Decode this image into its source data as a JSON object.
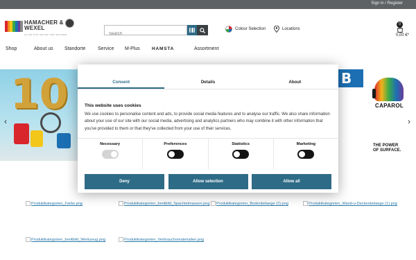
{
  "topbar": {
    "signin": "Sign in / Register"
  },
  "header": {
    "logo": {
      "name_line1": "HAMACHER &",
      "name_line2": "WEXEL",
      "tagline": "ALLES FÜR MALER UND MACHER"
    },
    "search": {
      "placeholder": "Search"
    },
    "colour_selection": "Colour Selection",
    "locations": "Locations",
    "cart": {
      "count": "0",
      "total": "0,00 €*"
    }
  },
  "nav": {
    "items": [
      "Shop",
      "About us",
      "Standorte",
      "Service",
      "M-Plus",
      "HAMSTA",
      "Assortment"
    ]
  },
  "hero": {
    "left_number": "10",
    "partial_letter": "B",
    "brand": "CAPAROL",
    "slogan_line1": "THE POWER",
    "slogan_line2": "OF SURFACE.",
    "prev_arrow": "‹",
    "next_arrow": "›"
  },
  "cookie_dialog": {
    "tabs": [
      {
        "label": "Consent",
        "active": true
      },
      {
        "label": "Details",
        "active": false
      },
      {
        "label": "About",
        "active": false
      }
    ],
    "title": "This website uses cookies",
    "body": "We use cookies to personalise content and ads, to provide social media features and to analyse our traffic. We also share information about your use of our site with our social media, advertising and analytics partners who may combine it with other information that you've provided to them or that they've collected from your use of their services.",
    "categories": [
      {
        "label": "Necessary",
        "enabled": true,
        "locked": true
      },
      {
        "label": "Preferences",
        "enabled": true,
        "locked": false
      },
      {
        "label": "Statistics",
        "enabled": true,
        "locked": false
      },
      {
        "label": "Marketing",
        "enabled": true,
        "locked": false
      }
    ],
    "buttons": {
      "deny": "Deny",
      "allow_selection": "Allow selection",
      "allow_all": "Allow all"
    }
  },
  "categories": [
    "Produktkategorien_Farbe.png",
    "Produktkategorien_breitbild_Spachtelmassen.png",
    "Produktkategorien_Bodenbelaege (2).png",
    "Produktkategorien_Wand-u-Deckenbelaege (1).png",
    "Produktkategorien_breitbild_Werkzeug.png",
    "Produktkategorien_Verbrauchsmaterialien.png"
  ],
  "colors": {
    "accent": "#2e6b86",
    "topbar": "#5f6264",
    "link": "#2a78a8"
  }
}
